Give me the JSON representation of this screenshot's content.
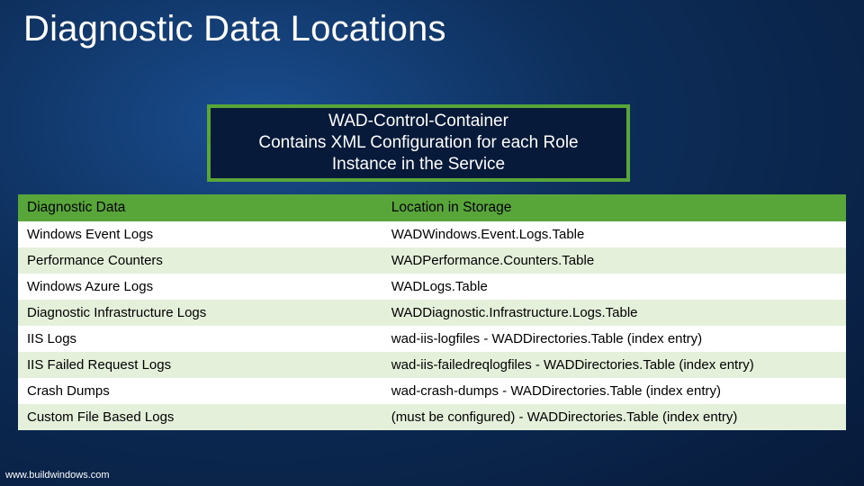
{
  "title": "Diagnostic Data Locations",
  "box": {
    "line1": "WAD-Control-Container",
    "line2": "Contains XML Configuration for each Role",
    "line3": "Instance in the Service"
  },
  "table": {
    "header": {
      "col1": "Diagnostic Data",
      "col2": "Location in Storage"
    },
    "rows": [
      {
        "c1": "Windows Event Logs",
        "c2": "WADWindows.Event.Logs.Table"
      },
      {
        "c1": "Performance Counters",
        "c2": "WADPerformance.Counters.Table"
      },
      {
        "c1": "Windows Azure Logs",
        "c2": "WADLogs.Table"
      },
      {
        "c1": "Diagnostic Infrastructure Logs",
        "c2": "WADDiagnostic.Infrastructure.Logs.Table"
      },
      {
        "c1": "IIS Logs",
        "c2": "wad-iis-logfiles  - WADDirectories.Table (index entry)"
      },
      {
        "c1": "IIS Failed Request Logs",
        "c2": "wad-iis-failedreqlogfiles  - WADDirectories.Table (index entry)"
      },
      {
        "c1": "Crash Dumps",
        "c2": "wad-crash-dumps - WADDirectories.Table (index entry)"
      },
      {
        "c1": "Custom File Based Logs",
        "c2": "(must be configured) - WADDirectories.Table (index entry)"
      }
    ]
  },
  "footer": "www.buildwindows.com"
}
